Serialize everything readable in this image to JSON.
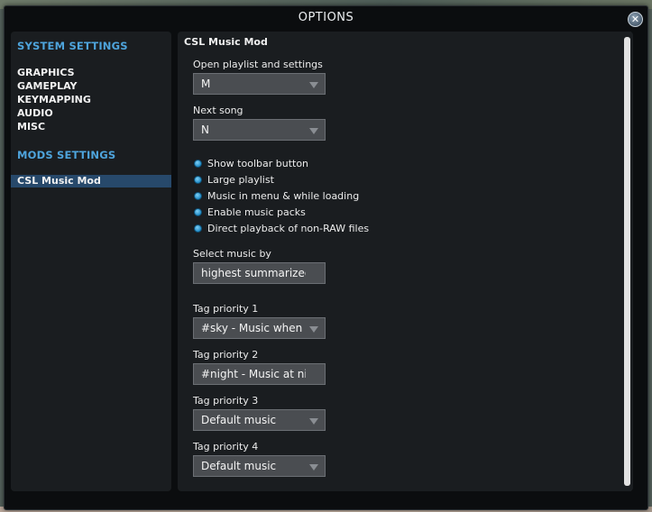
{
  "window": {
    "title": "OPTIONS"
  },
  "sidebar": {
    "system_heading": "SYSTEM SETTINGS",
    "system_items": [
      "GRAPHICS",
      "GAMEPLAY",
      "KEYMAPPING",
      "AUDIO",
      "MISC"
    ],
    "mods_heading": "MODS SETTINGS",
    "mods_items": [
      "CSL Music Mod"
    ],
    "selected": "CSL Music Mod"
  },
  "panel": {
    "title": "CSL Music Mod",
    "open_playlist": {
      "label": "Open playlist and settings",
      "value": "M"
    },
    "next_song": {
      "label": "Next song",
      "value": "N"
    },
    "checkboxes": [
      {
        "label": "Show toolbar button",
        "checked": true
      },
      {
        "label": "Large playlist",
        "checked": true
      },
      {
        "label": "Music in menu & while loading",
        "checked": true
      },
      {
        "label": "Enable music packs",
        "checked": true
      },
      {
        "label": "Direct playback of non-RAW files",
        "checked": true
      }
    ],
    "select_music": {
      "label": "Select music by",
      "value": "highest summarized"
    },
    "tag_priorities": [
      {
        "label": "Tag priority 1",
        "value": "#sky - Music when"
      },
      {
        "label": "Tag priority 2",
        "value": "#night - Music at night"
      },
      {
        "label": "Tag priority 3",
        "value": "Default music"
      },
      {
        "label": "Tag priority 4",
        "value": "Default music"
      }
    ]
  },
  "colors": {
    "accent": "#4ea4dc",
    "selected_bg": "#27496b",
    "dropdown_bg": "#4a4d51",
    "checkbox": "#1a86c3"
  },
  "icons": {
    "close": "close-icon",
    "dropdown": "chevron-down-icon",
    "checkbox": "checked-dot-icon"
  }
}
